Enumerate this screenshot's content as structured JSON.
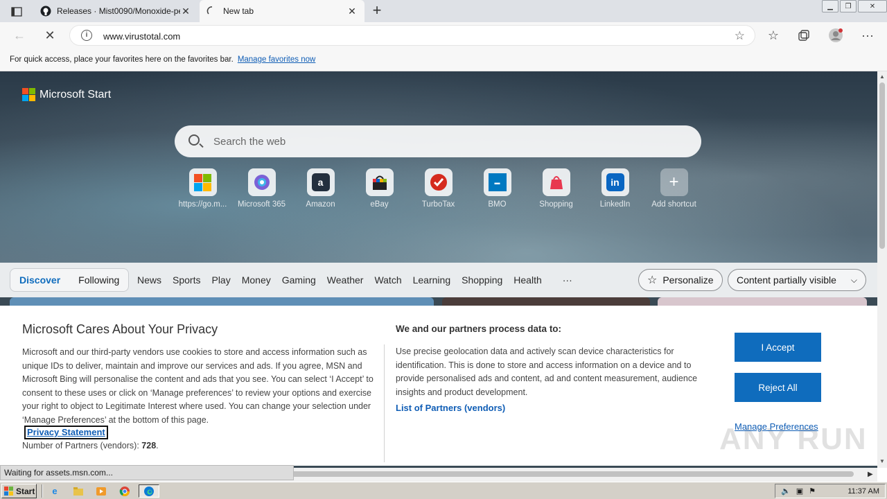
{
  "tabs": [
    {
      "title": "Releases · Mist0090/Monoxide-pe",
      "icon": "github-icon",
      "close": "✕"
    },
    {
      "title": "New tab",
      "icon": "loading-icon",
      "close": "✕"
    }
  ],
  "window_controls": {
    "minimize": "▁",
    "restore": "❐",
    "close": "✕"
  },
  "address": {
    "url": "www.virustotal.com"
  },
  "favorites_bar": {
    "text": "For quick access, place your favorites here on the favorites bar.",
    "link": "Manage favorites now"
  },
  "brand": {
    "name": "Microsoft Start"
  },
  "search": {
    "placeholder": "Search the web"
  },
  "shortcuts": [
    {
      "label": "https://go.m...",
      "icon": "microsoft-icon",
      "bg": "#ffffff"
    },
    {
      "label": "Microsoft 365",
      "icon": "m365-icon",
      "bg": "#6c5fd1"
    },
    {
      "label": "Amazon",
      "icon": "amazon-icon",
      "bg": "#232f3e"
    },
    {
      "label": "eBay",
      "icon": "ebay-icon",
      "bg": "#ffffff"
    },
    {
      "label": "TurboTax",
      "icon": "turbotax-icon",
      "bg": "#d52b1e"
    },
    {
      "label": "BMO",
      "icon": "bmo-icon",
      "bg": "#0079c1"
    },
    {
      "label": "Shopping",
      "icon": "shopping-icon",
      "bg": "#f3f3f3"
    },
    {
      "label": "LinkedIn",
      "icon": "linkedin-icon",
      "bg": "#0a66c2"
    },
    {
      "label": "Add shortcut",
      "icon": "plus-icon",
      "bg": "transparent"
    }
  ],
  "feed_tabs": {
    "discover": "Discover",
    "following": "Following"
  },
  "nav": [
    "News",
    "Sports",
    "Play",
    "Money",
    "Gaming",
    "Weather",
    "Watch",
    "Learning",
    "Shopping",
    "Health",
    "···"
  ],
  "personalize": "Personalize",
  "content_visibility": "Content partially visible",
  "privacy": {
    "title": "Microsoft Cares About Your Privacy",
    "body": "Microsoft and our third-party vendors use cookies to store and access information such as unique IDs to deliver, maintain and improve our services and ads. If you agree, MSN and Microsoft Bing will personalise the content and ads that you see. You can select ‘I Accept’ to consent to these uses or click on ‘Manage preferences’ to review your options and exercise your right to object to Legitimate Interest where used.  You can change your selection under ‘Manage Preferences’ at the bottom of this page.",
    "statement_link": "Privacy Statement",
    "partners_label": "Number of Partners (vendors): ",
    "partners_count": "728",
    "partners_suffix": ".",
    "process_title": "We and our partners process data to:",
    "process_desc": "Use precise geolocation data and actively scan device characteristics for identification. This is done to store and access information on a device and to provide personalised ads and content, ad and content measurement, audience insights and product development.",
    "partners_link": "List of Partners (vendors)",
    "accept": "I Accept",
    "reject": "Reject All",
    "manage": "Manage Preferences"
  },
  "watermark": "ANY RUN",
  "status": "Waiting for assets.msn.com...",
  "taskbar": {
    "start": "Start",
    "clock": "11:37 AM"
  }
}
